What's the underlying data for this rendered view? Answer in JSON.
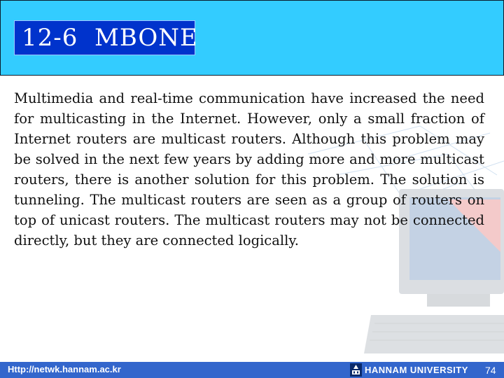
{
  "slide": {
    "title": "12-6  MBONE",
    "body": "Multimedia and real-time communication have increased the need for multicasting in the Internet. However, only a small fraction of Internet routers are multicast routers. Although this problem may be solved in the next few years by adding more and more multicast routers, there is another solution for this problem. The solution is tunneling. The multicast routers are seen as a group of routers on top of unicast routers. The multicast routers may not be connected directly, but they are connected logically."
  },
  "footer": {
    "url": "Http://netwk.hannam.ac.kr",
    "logo_icon": "university-emblem-icon",
    "university": "HANNAM  UNIVERSITY",
    "page_number": "74"
  },
  "background": {
    "decoration_icon": "computer-network-illustration"
  },
  "colors": {
    "header_bg": "#33ccff",
    "title_box_bg": "#0033cc",
    "footer_bg": "#3366cc",
    "text": "#111111"
  }
}
